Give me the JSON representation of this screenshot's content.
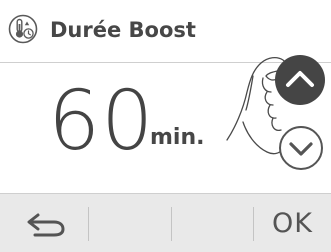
{
  "header": {
    "title": "Durée Boost",
    "icon": "thermometer-clock-icon"
  },
  "value": {
    "number": "60",
    "unit": "min."
  },
  "controls": {
    "up_icon": "chevron-up-icon",
    "down_icon": "chevron-down-icon",
    "hand_icon": "pressing-hand-illustration"
  },
  "footer": {
    "back_icon": "back-arrow-icon",
    "ok_label": "OK"
  },
  "colors": {
    "text": "#474747",
    "up_button_bg": "#454545",
    "footer_bg": "#e9e9e9"
  }
}
